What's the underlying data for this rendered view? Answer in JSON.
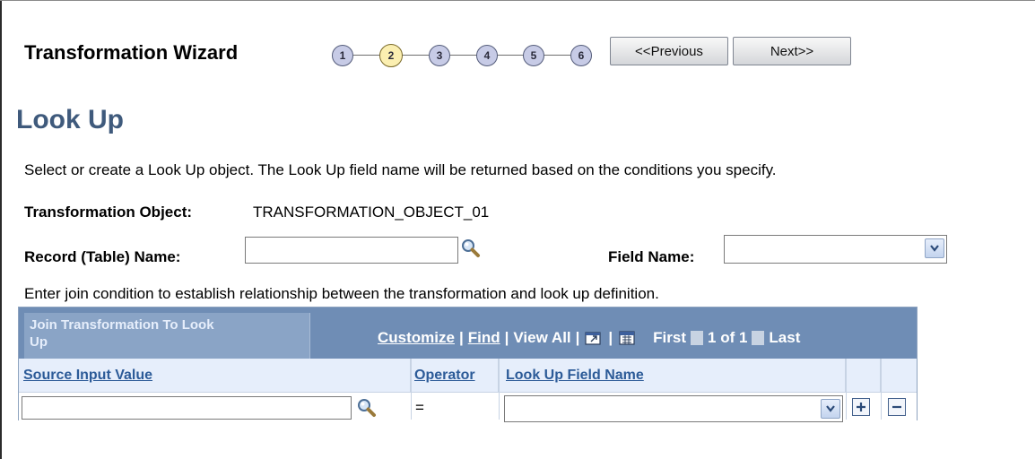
{
  "wizard": {
    "title": "Transformation Wizard",
    "steps": [
      "1",
      "2",
      "3",
      "4",
      "5",
      "6"
    ],
    "active_step": "2",
    "previous_label": "<<Previous",
    "next_label": "Next>>"
  },
  "page": {
    "title": "Look Up",
    "instructions": "Select or create a Look Up object. The Look Up field name will be returned based on the conditions you specify.",
    "transformation_object_label": "Transformation Object:",
    "transformation_object_value": "TRANSFORMATION_OBJECT_01",
    "record_name_label": "Record (Table) Name:",
    "record_name_value": "",
    "field_name_label": "Field Name:",
    "field_name_value": "",
    "join_instructions": "Enter join condition to establish relationship between the transformation and look up definition."
  },
  "grid": {
    "title_line1": "Join Transformation To Look",
    "title_line2": "Up",
    "customize": "Customize",
    "find": "Find",
    "view_all": "View All",
    "first": "First",
    "range": "1 of 1",
    "last": "Last",
    "columns": {
      "source_input_value": "Source Input Value",
      "operator": "Operator",
      "look_up_field_name": "Look Up Field Name"
    },
    "rows": [
      {
        "source_input_value": "",
        "operator": "=",
        "look_up_field_name": ""
      }
    ]
  },
  "colors": {
    "title_blue": "#3f5a7c",
    "grid_header": "#6f8db5",
    "link_blue": "#2c5b98",
    "active_step": "#fbefb1",
    "inactive_step": "#c7cbe6"
  },
  "icons": [
    "lookup-icon",
    "dropdown-arrow-icon",
    "zoom-icon",
    "download-icon",
    "prev-arrow-icon",
    "next-arrow-icon",
    "add-row-icon",
    "delete-row-icon"
  ]
}
